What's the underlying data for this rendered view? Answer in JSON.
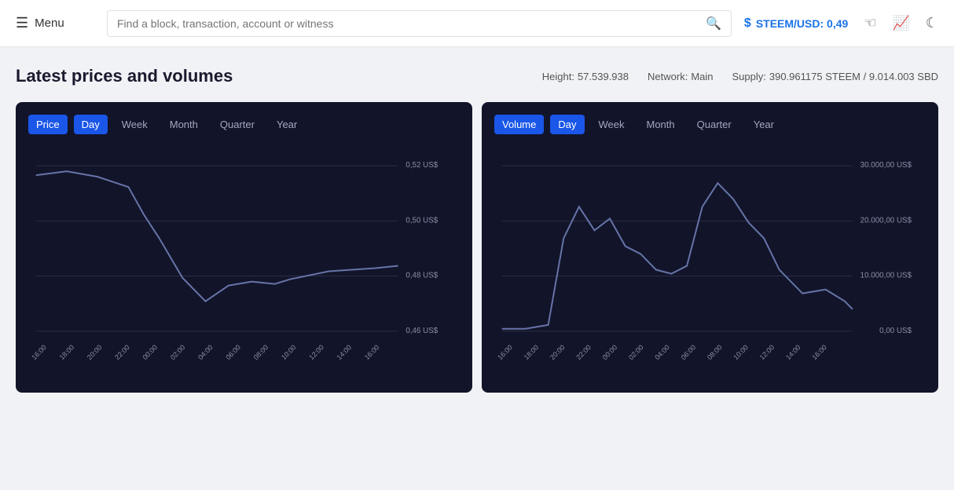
{
  "header": {
    "menu_label": "Menu",
    "search_placeholder": "Find a block, transaction, account or witness",
    "price_label": "STEEM/USD: 0,49"
  },
  "page": {
    "title": "Latest prices and volumes",
    "meta": {
      "height_label": "Height:",
      "height_value": "57.539.938",
      "network_label": "Network:",
      "network_value": "Main",
      "supply_label": "Supply:",
      "supply_value": "390.961175 STEEM / 9.014.003 SBD"
    }
  },
  "price_chart": {
    "type_label": "Price",
    "tabs": [
      "Day",
      "Week",
      "Month",
      "Quarter",
      "Year"
    ],
    "active_type": "Price",
    "active_tab": "Day",
    "y_labels": [
      "0,52 US$",
      "0,50 US$",
      "0,48 US$",
      "0,46 US$"
    ],
    "x_labels": [
      "16:00",
      "18:00",
      "20:00",
      "22:00",
      "00:00",
      "02:00",
      "04:00",
      "06:00",
      "08:00",
      "10:00",
      "12:00",
      "14:00",
      "16:00"
    ]
  },
  "volume_chart": {
    "type_label": "Volume",
    "tabs": [
      "Day",
      "Week",
      "Month",
      "Quarter",
      "Year"
    ],
    "active_type": "Volume",
    "active_tab": "Day",
    "y_labels": [
      "30.000,00 US$",
      "20.000,00 US$",
      "10.000,00 US$",
      "0,00 US$"
    ],
    "x_labels": [
      "16:00",
      "18:00",
      "20:00",
      "22:00",
      "00:00",
      "02:00",
      "04:00",
      "06:00",
      "08:00",
      "10:00",
      "12:00",
      "14:00",
      "16:00"
    ]
  }
}
